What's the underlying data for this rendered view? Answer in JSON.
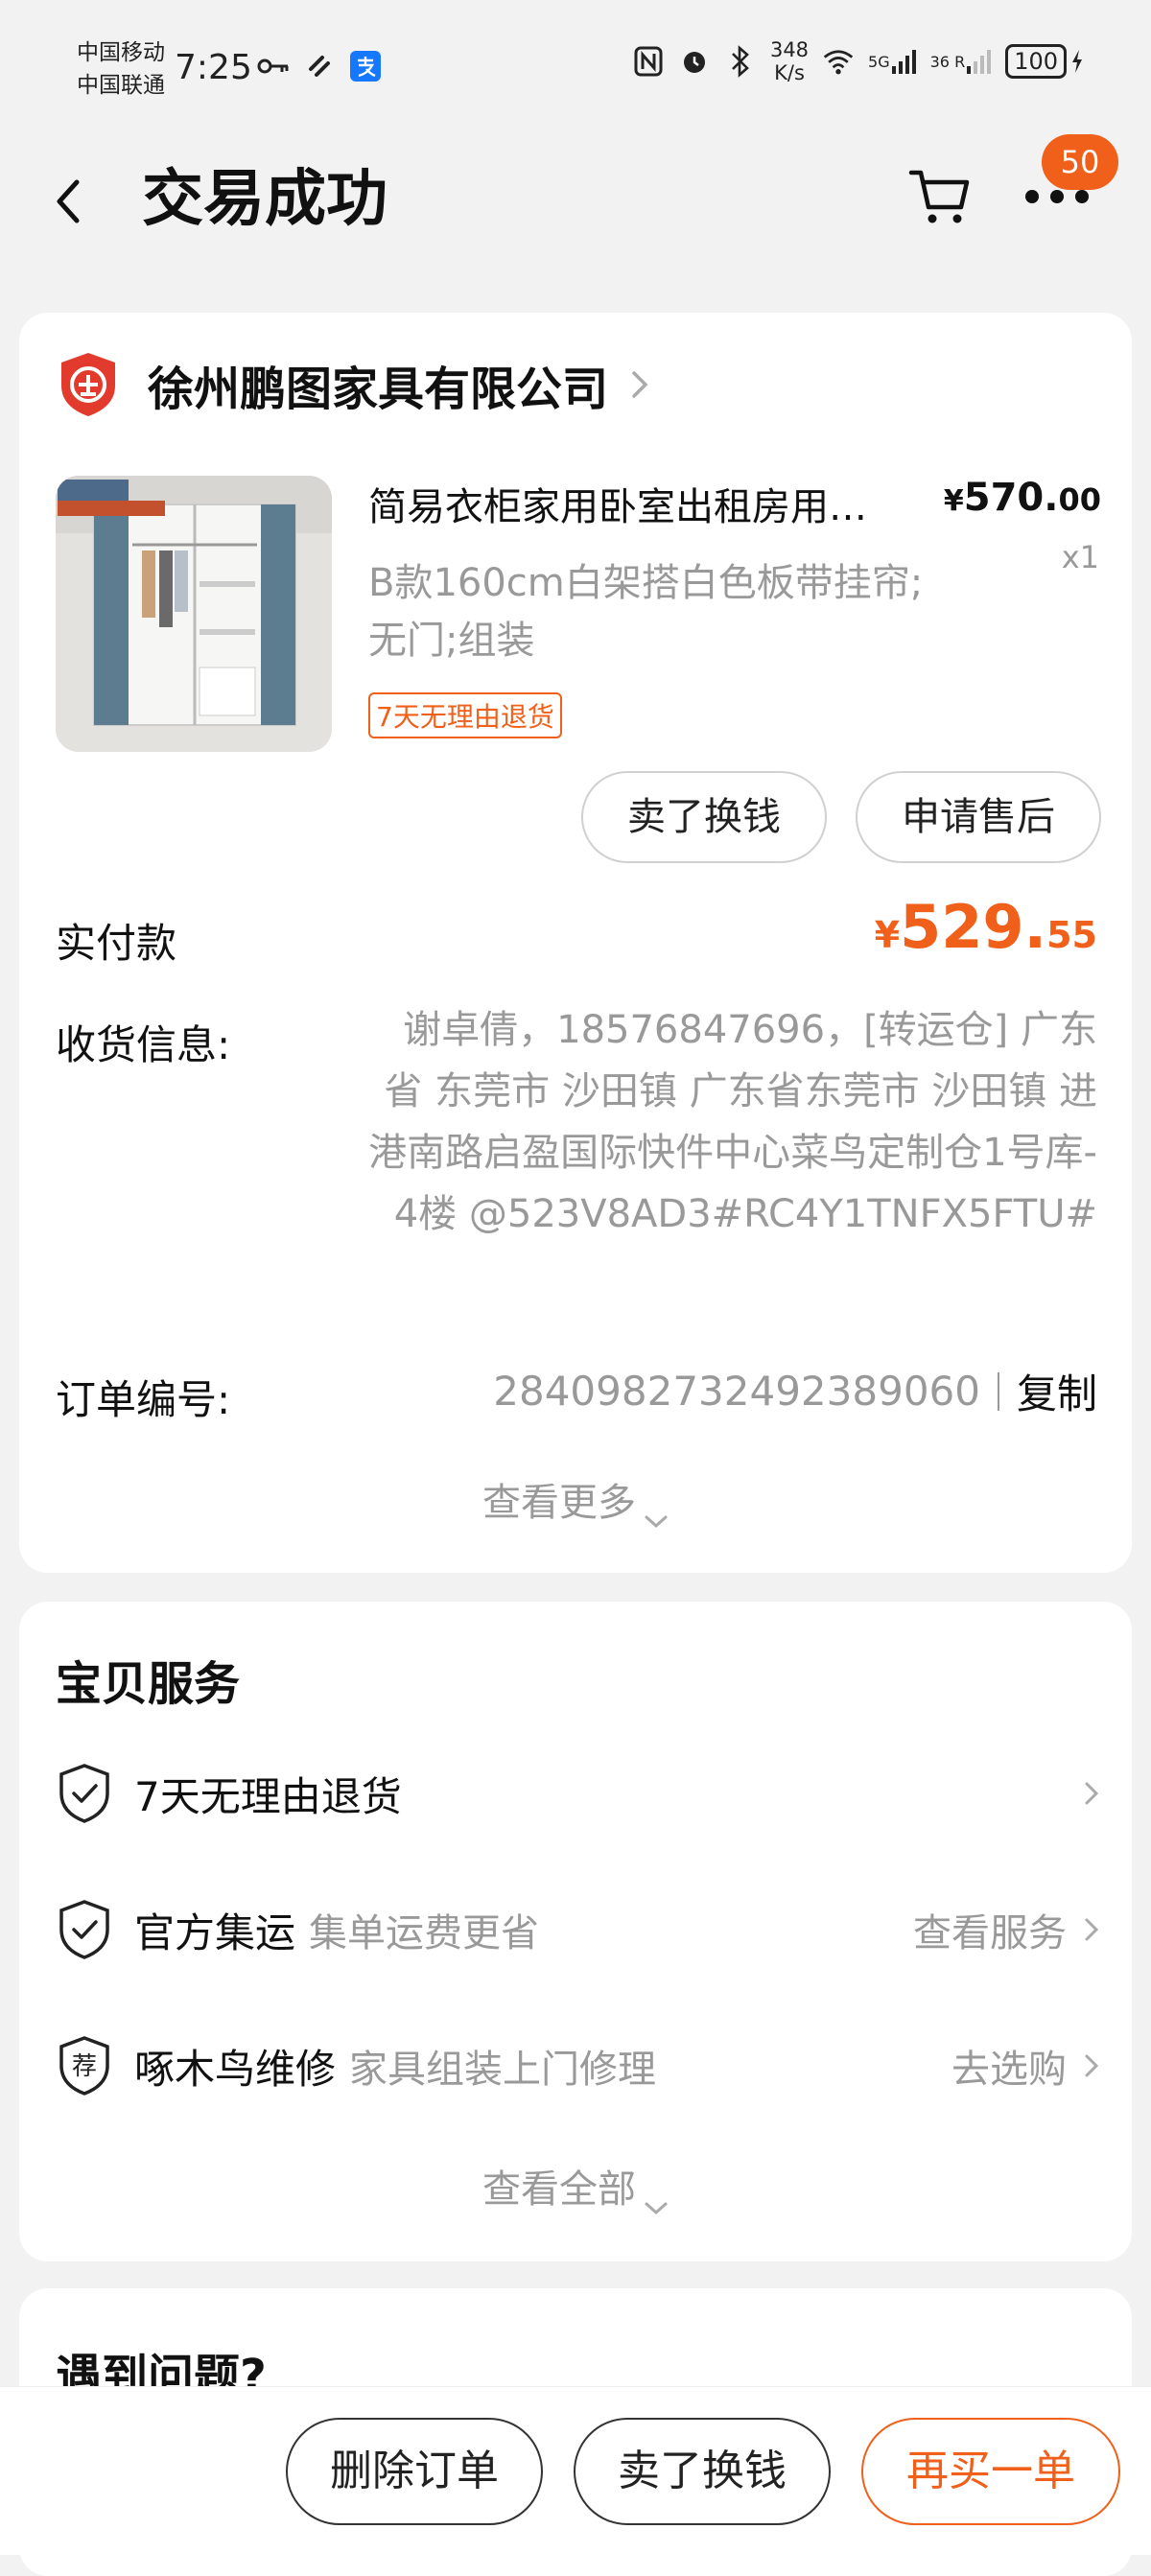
{
  "status_bar": {
    "carrier_1": "中国移动",
    "carrier_2": "中国联通",
    "time": "7:25",
    "net_speed_value": "348",
    "net_speed_unit": "K/s",
    "signal_1": "5G",
    "signal_2": "36 R",
    "battery": "100"
  },
  "nav": {
    "title": "交易成功",
    "badge_count": "50"
  },
  "order": {
    "store_name": "徐州鹏图家具有限公司",
    "product_title": "简易衣柜家用卧室出租房用…",
    "price_currency": "¥",
    "price_int": "570.",
    "price_dec": "00",
    "quantity": "x1",
    "spec": "B款160cm白架搭白色板带挂帘;无门;组装",
    "return_tag": "7天无理由退货",
    "btn_sell": "卖了换钱",
    "btn_aftersale": "申请售后",
    "paid_label": "实付款",
    "paid_currency": "¥",
    "paid_int": "529.",
    "paid_dec": "55",
    "address_label": "收货信息:",
    "address_value": "谢卓倩，18576847696，[转运仓] 广东省 东莞市 沙田镇 广东省东莞市 沙田镇 进港南路启盈国际快件中心菜鸟定制仓1号库-4楼 @523V8AD3#RC4Y1TNFX5FTU#",
    "order_no_label": "订单编号:",
    "order_no_value": "2840982732492389060",
    "copy": "复制",
    "see_more": "查看更多"
  },
  "services": {
    "title": "宝贝服务",
    "items": [
      {
        "name": "7天无理由退货",
        "desc": "",
        "action": "",
        "icon": "shield-check-icon"
      },
      {
        "name": "官方集运",
        "desc": "集单运费更省",
        "action": "查看服务",
        "icon": "shield-check-icon"
      },
      {
        "name": "啄木鸟维修",
        "desc": "家具组装上门修理",
        "action": "去选购",
        "icon": "recommend-shield-icon"
      }
    ],
    "see_all": "查看全部"
  },
  "problem": {
    "title": "遇到问题?"
  },
  "bottom_bar": {
    "delete": "删除订单",
    "sell": "卖了换钱",
    "rebuy": "再买一单"
  },
  "colors": {
    "accent": "#f0601a",
    "background": "#f2f2f2",
    "muted_text": "#999999"
  }
}
